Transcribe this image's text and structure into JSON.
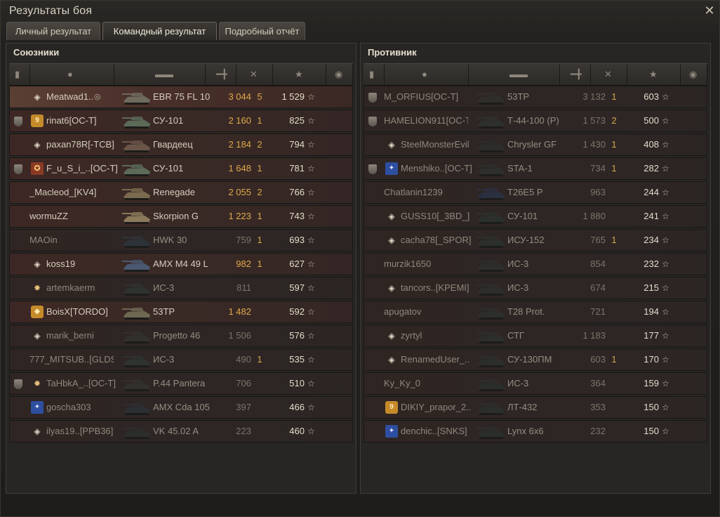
{
  "window": {
    "title": "Результаты боя",
    "close_glyph": "✕"
  },
  "tabs": [
    {
      "label": "Личный результат",
      "active": false
    },
    {
      "label": "Командный результат",
      "active": true
    },
    {
      "label": "Подробный отчёт",
      "active": false
    }
  ],
  "colors": {
    "accent_damage": "#e0a94b",
    "frag": "#d9a54b",
    "dim": "#7a746a",
    "row_red": "#4a2626",
    "row_highlight": "#5a3a30"
  },
  "allies": {
    "title": "Союзники",
    "rows": [
      {
        "rank": false,
        "badge": "diamond",
        "name": "Meatwad1..",
        "vehicle": "EBR 75 FL 10",
        "damage": "3 044",
        "frags": "5",
        "xp": "1 529",
        "alive": true,
        "highlight": true,
        "tank_color": "#6e6a5e"
      },
      {
        "rank": true,
        "badge": "gold9",
        "name": "rinat6[OC-T]",
        "vehicle": "СУ-101",
        "damage": "2 160",
        "frags": "1",
        "xp": "825",
        "alive": true,
        "tank_color": "#5c6a58"
      },
      {
        "rank": false,
        "badge": "diamond",
        "name": "paxan78R[-TCB]",
        "vehicle": "Гвардеец",
        "damage": "2 184",
        "frags": "2",
        "xp": "794",
        "alive": true,
        "tank_color": "#6a5548"
      },
      {
        "rank": true,
        "badge": "red",
        "name": "F_u_S_i_..[OC-T]",
        "vehicle": "СУ-101",
        "damage": "1 648",
        "frags": "1",
        "xp": "781",
        "alive": true,
        "tank_color": "#5c6a58"
      },
      {
        "rank": false,
        "badge": "",
        "name": "_Macleod_[KV4]",
        "vehicle": "Renegade",
        "damage": "2 055",
        "frags": "2",
        "xp": "766",
        "alive": true,
        "tank_color": "#7a6a4e"
      },
      {
        "rank": false,
        "badge": "",
        "name": "wormuZZ",
        "vehicle": "Skorpion G",
        "damage": "1 223",
        "frags": "1",
        "xp": "743",
        "alive": true,
        "tank_color": "#8a7a5a"
      },
      {
        "rank": false,
        "badge": "",
        "name": "MAOin",
        "vehicle": "HWK 30",
        "damage": "759",
        "frags": "1",
        "xp": "693",
        "alive": false,
        "tank_color": "#2e333a"
      },
      {
        "rank": false,
        "badge": "diamond",
        "name": "koss19",
        "vehicle": "AMX M4 49 L",
        "damage": "982",
        "frags": "1",
        "xp": "627",
        "alive": true,
        "tank_color": "#4a5870"
      },
      {
        "rank": false,
        "badge": "star",
        "name": "artemkaerm",
        "vehicle": "ИС-3",
        "damage": "811",
        "frags": "",
        "xp": "597",
        "alive": false,
        "tank_color": "#2e3330"
      },
      {
        "rank": false,
        "badge": "gold",
        "name": "BoisX[TORDO]",
        "vehicle": "53TP",
        "damage": "1 482",
        "frags": "",
        "xp": "592",
        "alive": true,
        "tank_color": "#6e6a52"
      },
      {
        "rank": false,
        "badge": "diamond",
        "name": "marik_berni",
        "vehicle": "Progetto 46",
        "damage": "1 506",
        "frags": "",
        "xp": "576",
        "alive": false,
        "tank_color": "#33302c"
      },
      {
        "rank": false,
        "badge": "",
        "name": "777_MITSUB..[GLDS]",
        "vehicle": "ИС-3",
        "damage": "490",
        "frags": "1",
        "xp": "535",
        "alive": false,
        "tank_color": "#2e3330"
      },
      {
        "rank": true,
        "badge": "star",
        "name": "TaHbkA_..[OC-T]",
        "vehicle": "P.44 Pantera",
        "damage": "706",
        "frags": "",
        "xp": "510",
        "alive": false,
        "tank_color": "#32302c"
      },
      {
        "rank": false,
        "badge": "blue",
        "name": "goscha303",
        "vehicle": "AMX Cda 105",
        "damage": "397",
        "frags": "",
        "xp": "466",
        "alive": false,
        "tank_color": "#2c2f33"
      },
      {
        "rank": false,
        "badge": "diamond",
        "name": "ilyas19..[PPB36]",
        "vehicle": "VK 45.02 A",
        "damage": "223",
        "frags": "",
        "xp": "460",
        "alive": false,
        "tank_color": "#2c2e2c"
      }
    ]
  },
  "enemies": {
    "title": "Противник",
    "rows": [
      {
        "rank": true,
        "badge": "",
        "name": "M_ORFIUS[OC-T]",
        "vehicle": "53TP",
        "damage": "3 132",
        "frags": "1",
        "xp": "603",
        "alive": false,
        "tank_color": "#302e2a"
      },
      {
        "rank": true,
        "badge": "",
        "name": "HAMELION911[OC-T]",
        "vehicle": "Т-44-100 (Р)",
        "damage": "1 573",
        "frags": "2",
        "xp": "500",
        "alive": false,
        "tank_color": "#2e302c"
      },
      {
        "rank": false,
        "badge": "diamond",
        "name": "SteelMonsterEvil",
        "vehicle": "Chrysler GF",
        "damage": "1 430",
        "frags": "1",
        "xp": "408",
        "alive": false,
        "tank_color": "#2c2c2a"
      },
      {
        "rank": true,
        "badge": "blue",
        "name": "Menshiko..[OC-T]",
        "vehicle": "STA-1",
        "damage": "734",
        "frags": "1",
        "xp": "282",
        "alive": false,
        "tank_color": "#2c2f2c"
      },
      {
        "rank": false,
        "badge": "",
        "name": "Chatlanin1239",
        "vehicle": "T26E5 P",
        "damage": "963",
        "frags": "",
        "xp": "244",
        "alive": false,
        "tank_color": "#2a3040"
      },
      {
        "rank": false,
        "badge": "diamond",
        "name": "GUSS10[_3BD_]",
        "vehicle": "СУ-101",
        "damage": "1 880",
        "frags": "",
        "xp": "241",
        "alive": false,
        "tank_color": "#2c302c"
      },
      {
        "rank": false,
        "badge": "diamond",
        "name": "cacha78[_SPOR]",
        "vehicle": "ИСУ-152",
        "damage": "765",
        "frags": "1",
        "xp": "234",
        "alive": false,
        "tank_color": "#2c302c"
      },
      {
        "rank": false,
        "badge": "",
        "name": "murzik1650",
        "vehicle": "ИС-3",
        "damage": "854",
        "frags": "",
        "xp": "232",
        "alive": false,
        "tank_color": "#2c2e2c"
      },
      {
        "rank": false,
        "badge": "diamond",
        "name": "tancors..[KPEMI]",
        "vehicle": "ИС-3",
        "damage": "674",
        "frags": "",
        "xp": "215",
        "alive": false,
        "tank_color": "#2c2e2c"
      },
      {
        "rank": false,
        "badge": "",
        "name": "apugatov",
        "vehicle": "T28 Prot.",
        "damage": "721",
        "frags": "",
        "xp": "194",
        "alive": false,
        "tank_color": "#2c2e2c"
      },
      {
        "rank": false,
        "badge": "diamond",
        "name": "zyrtyl",
        "vehicle": "СТГ",
        "damage": "1 183",
        "frags": "",
        "xp": "177",
        "alive": false,
        "tank_color": "#2c2e2c"
      },
      {
        "rank": false,
        "badge": "diamond",
        "name": "RenamedUser_..",
        "vehicle": "СУ-130ПМ",
        "damage": "603",
        "frags": "1",
        "xp": "170",
        "alive": false,
        "tank_color": "#2c2e2c"
      },
      {
        "rank": false,
        "badge": "",
        "name": "Ky_Ky_0",
        "vehicle": "ИС-3",
        "damage": "364",
        "frags": "",
        "xp": "159",
        "alive": false,
        "tank_color": "#2c2e2c"
      },
      {
        "rank": false,
        "badge": "gold9",
        "name": "DIKIY_prapor_2..",
        "vehicle": "ЛТ-432",
        "damage": "353",
        "frags": "",
        "xp": "150",
        "alive": false,
        "tank_color": "#2c2e2c"
      },
      {
        "rank": false,
        "badge": "blue",
        "name": "denchic..[SNKS]",
        "vehicle": "Lynx 6x6",
        "damage": "232",
        "frags": "",
        "xp": "150",
        "alive": false,
        "tank_color": "#2c2e2c"
      }
    ]
  },
  "header_icons": [
    "rank-icon",
    "player-icon",
    "tank-icon",
    "damage-icon",
    "frags-icon",
    "xp-star-icon",
    "medal-icon"
  ]
}
